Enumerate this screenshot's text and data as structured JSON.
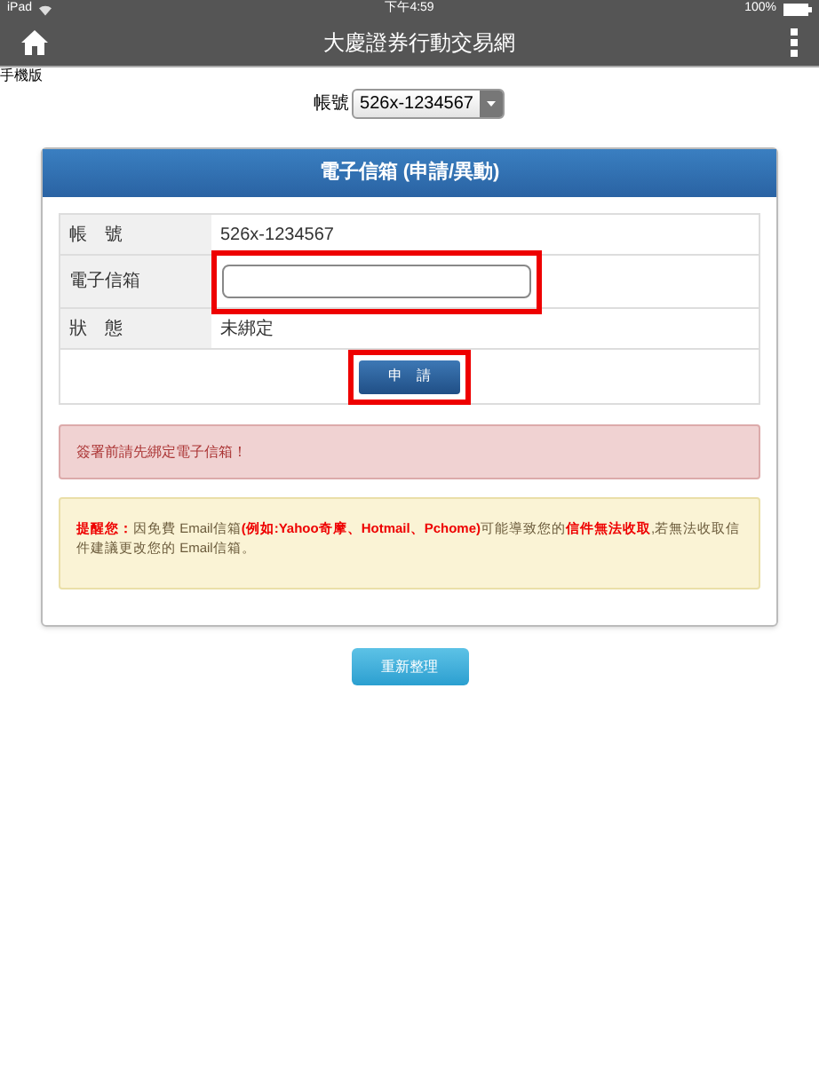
{
  "status_bar": {
    "device": "iPad",
    "time": "下午4:59",
    "battery": "100%"
  },
  "nav": {
    "title": "大慶證券行動交易網"
  },
  "mobile_label": "手機版",
  "account_select": {
    "label": "帳號",
    "value": "526x-1234567"
  },
  "card": {
    "title": "電子信箱 (申請/異動)",
    "rows": [
      {
        "kind": "text",
        "label": "帳　號",
        "value": "526x-1234567"
      },
      {
        "kind": "input",
        "label": "電子信箱",
        "highlighted": true
      },
      {
        "kind": "text",
        "label": "狀　態",
        "value": "未綁定"
      }
    ],
    "submit": {
      "label": "申　請",
      "highlighted": true
    },
    "alert": "簽署前請先綁定電子信箱！",
    "notice": "**提醒您：**因免費 Email信箱**(例如:Yahoo奇摩、Hotmail、Pchome)**可能導致您的**信件無法收取**,若無法收取信件建議更改您的 Email信箱。"
  },
  "refresh_button": "重新整理"
}
